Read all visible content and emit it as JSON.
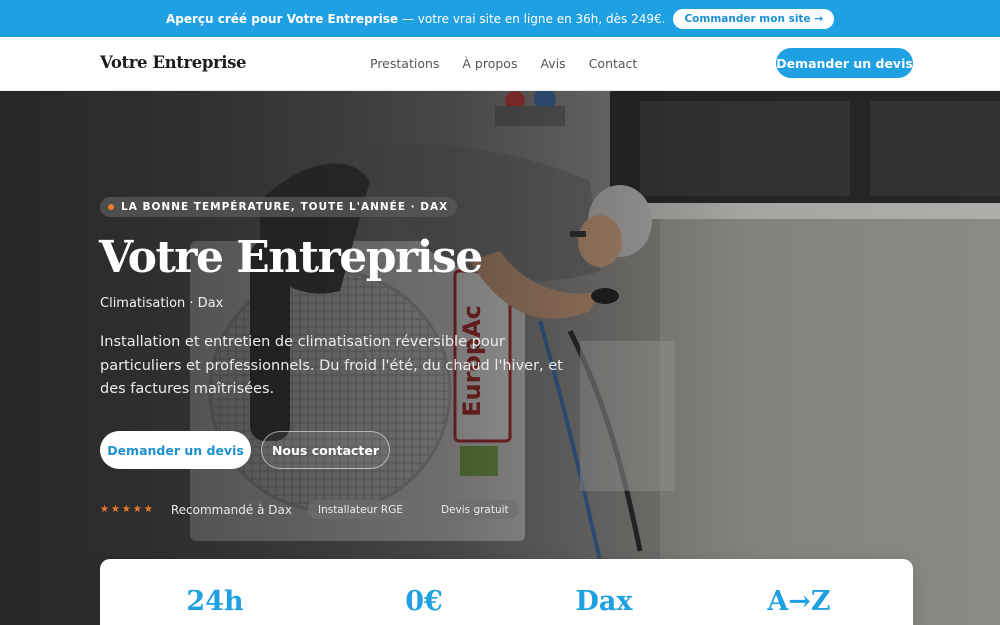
{
  "announcement": {
    "lead": "Aperçu créé pour Votre Entreprise",
    "rest": "— votre vrai site en ligne en 36h, dès 249€.",
    "cta": "Commander mon site →"
  },
  "header": {
    "brand": "Votre Entreprise",
    "nav": [
      "Prestations",
      "À propos",
      "Avis",
      "Contact"
    ],
    "cta": "Demander un devis"
  },
  "hero": {
    "tagline": "LA BONNE TEMPÉRATURE, TOUTE L'ANNÉE · DAX",
    "title": "Votre Entreprise",
    "subtitle": "Climatisation · Dax",
    "description": "Installation et entretien de climatisation réversible pour particuliers et professionnels. Du froid l'été, du chaud l'hiver, et des factures maîtrisées.",
    "primary_cta": "Demander un devis",
    "secondary_cta": "Nous contacter",
    "stars": "★★★★★",
    "recommendation": "Recommandé à Dax",
    "badges": [
      "Installateur RGE",
      "Devis gratuit"
    ],
    "image_alt_icon": "technician-photo",
    "unit_brand": "EuropAc"
  },
  "stats": [
    "24h",
    "0€",
    "Dax",
    "A→Z"
  ],
  "colors": {
    "accent": "#1fa0e2",
    "star": "#f07b2c",
    "hero_overlay": "#141416"
  }
}
